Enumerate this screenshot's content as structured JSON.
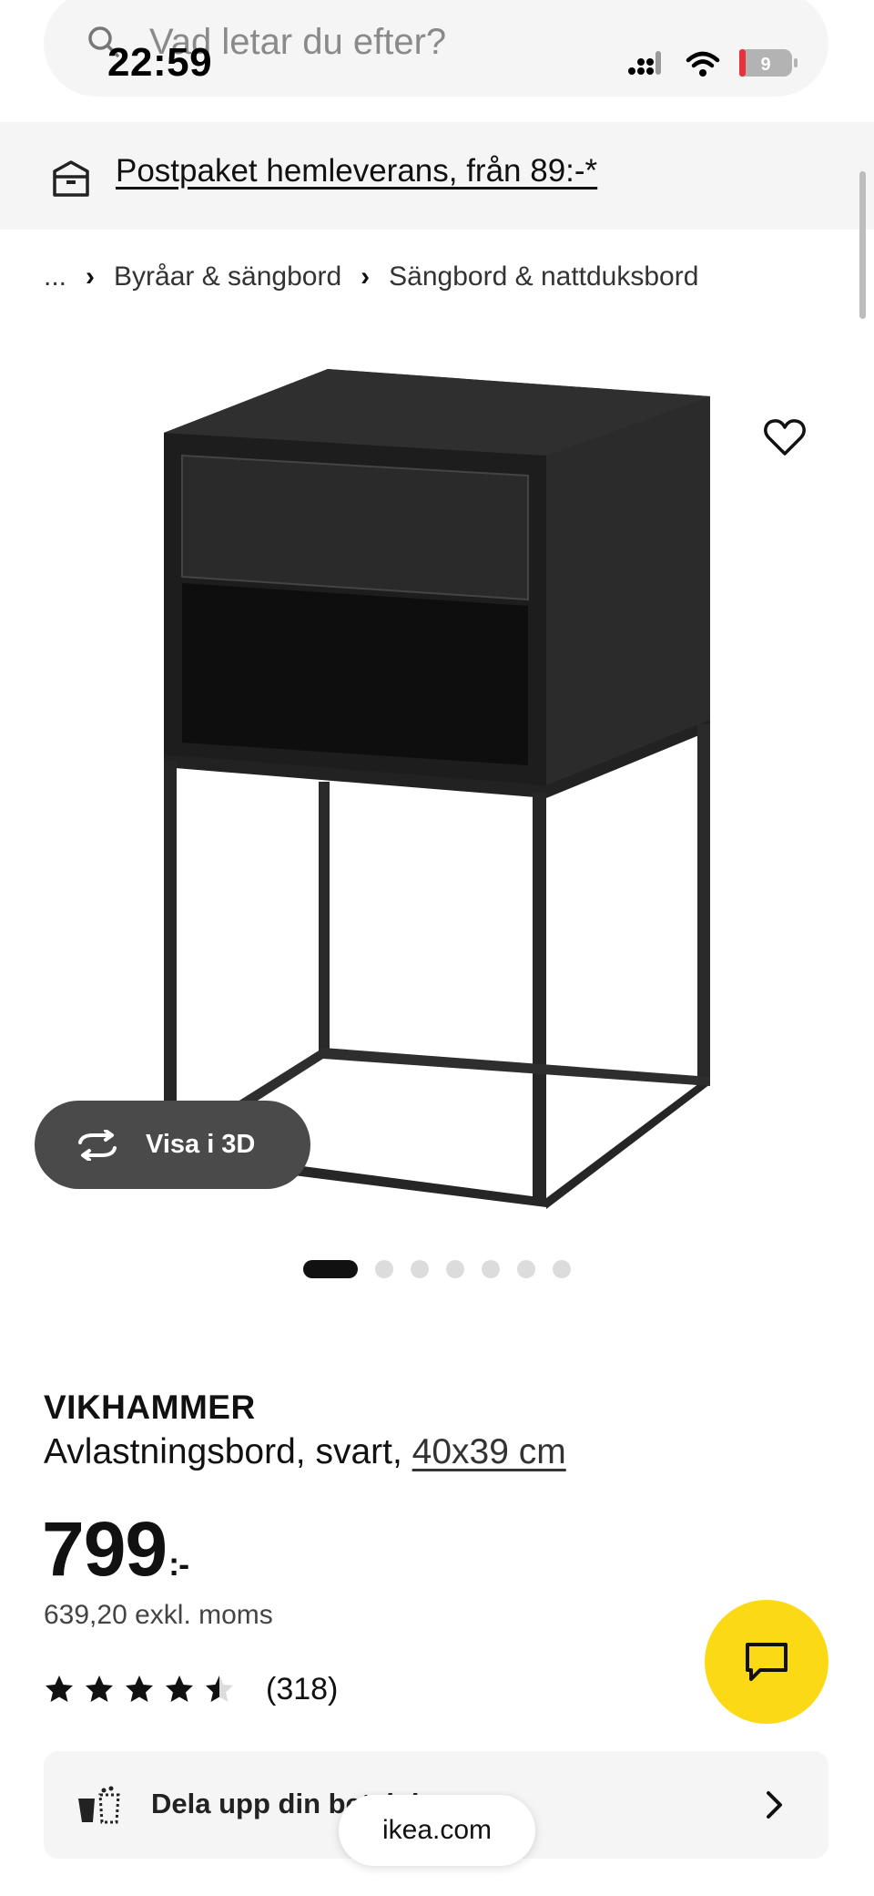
{
  "status_bar": {
    "time": "22:59",
    "battery_level": "9"
  },
  "search": {
    "placeholder": "Vad letar du efter?"
  },
  "banner": {
    "text": "Postpaket hemleverans, från 89:-*"
  },
  "breadcrumb": {
    "items": [
      "...",
      "Byråar & sängbord",
      "Sängbord & nattduksbord"
    ]
  },
  "gallery": {
    "view_3d_label": "Visa i 3D",
    "slide_count": 7,
    "active_slide": 1
  },
  "product": {
    "name": "VIKHAMMER",
    "description": "Avlastningsbord, svart,",
    "size": "40x39 cm",
    "price": "799",
    "price_suffix": ":-",
    "price_ex_vat": "639,20 exkl. moms",
    "rating_value": 4.5,
    "rating_max": 5,
    "review_count": "(318)"
  },
  "split_payment": {
    "label": "Dela upp din betalning"
  },
  "browser": {
    "url": "ikea.com"
  },
  "colors": {
    "chat_fab": "#fbd914",
    "view3d_bg": "#4a4a4a",
    "banner_bg": "#f5f5f5"
  }
}
